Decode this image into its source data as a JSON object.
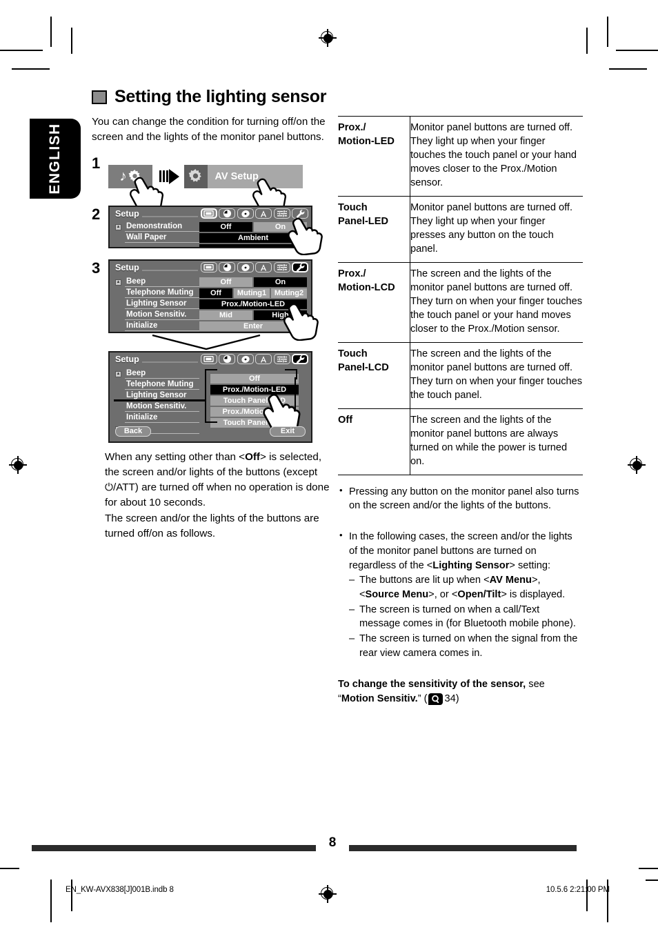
{
  "language_tab": "ENGLISH",
  "heading": "Setting the lighting sensor",
  "intro": "You can change the condition for turning off/on the screen and the lights of the monitor panel buttons.",
  "steps": {
    "one": {
      "number": "1",
      "source_icon": "music-note-gear-icon",
      "av_setup_label": "AV Setup",
      "av_setup_icon": "gear-icon",
      "arrow_icon": "right-arrow-icon"
    },
    "two": {
      "number": "2",
      "screen": {
        "title": "Setup",
        "tabs": [
          "monitor-icon",
          "clock-icon",
          "disc-icon",
          "text-a-icon",
          "equalizer-icon",
          "wrench-icon"
        ],
        "selected_tab_index": 0,
        "rows": [
          {
            "label": "Demonstration",
            "values": [
              {
                "text": "Off",
                "selected": true
              },
              {
                "text": "On",
                "selected": false
              }
            ]
          },
          {
            "label": "Wall Paper",
            "values": [
              {
                "text": "Ambient",
                "selected": true
              }
            ]
          }
        ]
      }
    },
    "three": {
      "number": "3",
      "screen_a": {
        "title": "Setup",
        "tabs": [
          "monitor-icon",
          "clock-icon",
          "disc-icon",
          "text-a-icon",
          "equalizer-icon",
          "wrench-icon"
        ],
        "selected_tab_index": 5,
        "rows": [
          {
            "label": "Beep",
            "values": [
              {
                "text": "Off",
                "selected": false
              },
              {
                "text": "On",
                "selected": true
              }
            ]
          },
          {
            "label": "Telephone Muting",
            "values": [
              {
                "text": "Off",
                "selected": true
              },
              {
                "text": "Muting1",
                "selected": false
              },
              {
                "text": "Muting2",
                "selected": false
              }
            ]
          },
          {
            "label": "Lighting Sensor",
            "values": [
              {
                "text": "Prox./Motion-LED",
                "selected": true
              }
            ]
          },
          {
            "label": "Motion Sensitiv.",
            "values": [
              {
                "text": "Mid",
                "selected": false
              },
              {
                "text": "High",
                "selected": true
              }
            ]
          },
          {
            "label": "Initialize",
            "values": [
              {
                "text": "Enter",
                "selected": false
              }
            ]
          }
        ]
      },
      "screen_b": {
        "title": "Setup",
        "tabs": [
          "monitor-icon",
          "clock-icon",
          "disc-icon",
          "text-a-icon",
          "equalizer-icon",
          "wrench-icon"
        ],
        "selected_tab_index": 5,
        "rows": [
          "Beep",
          "Telephone Muting",
          "Lighting Sensor",
          "Motion Sensitiv.",
          "Initialize"
        ],
        "dropdown": [
          {
            "text": "Off",
            "selected": false
          },
          {
            "text": "Prox./Motion-LED",
            "selected": true
          },
          {
            "text": "Touch Panel-LED",
            "selected": false
          },
          {
            "text": "Prox./Motion-LCD",
            "selected": false
          },
          {
            "text": "Touch Panel-LCD",
            "selected": false
          }
        ],
        "back_label": "Back",
        "exit_label": "Exit"
      }
    }
  },
  "left_note": {
    "line1_a": "When any setting other than <",
    "line1_b": "Off",
    "line1_c": "> is selected, the screen and/or lights of the buttons (except ⏻/ATT) are turned off when no operation is done for about 10 seconds.",
    "line2": "The screen and/or the lights of the buttons are turned off/on as follows."
  },
  "table": {
    "rows": [
      {
        "name": "Prox./\nMotion-LED",
        "desc": "Monitor panel buttons are turned off. They light up when your finger touches the touch panel or your hand moves closer to the Prox./Motion sensor."
      },
      {
        "name": "Touch\nPanel-LED",
        "desc": "Monitor panel buttons are turned off. They light up when your finger presses any button on the touch panel."
      },
      {
        "name": "Prox./\nMotion-LCD",
        "desc": "The screen and the lights of the monitor panel buttons are turned off. They turn on when your finger touches the touch panel or your hand moves closer to the Prox./Motion sensor."
      },
      {
        "name": "Touch\nPanel-LCD",
        "desc": "The screen and the lights of the monitor panel buttons are turned off. They turn on when your finger touches the touch panel."
      },
      {
        "name": "Off",
        "desc": "The screen and the lights of the monitor panel buttons are always turned on while the power is turned on."
      }
    ]
  },
  "notes": {
    "note1": "Pressing any button on the monitor panel also turns on the screen and/or the lights of the buttons.",
    "note2_intro_a": "In the following cases, the screen and/or the lights of the monitor panel buttons are turned on regardless of the <",
    "note2_intro_b": "Lighting Sensor",
    "note2_intro_c": "> setting:",
    "sub1_a": "The buttons are lit up when <",
    "sub1_b": "AV Menu",
    "sub1_c": ">, <",
    "sub1_d": "Source Menu",
    "sub1_e": ">, or <",
    "sub1_f": "Open/Tilt",
    "sub1_g": "> is displayed.",
    "sub2": "The screen is turned on when a call/Text message comes in (for Bluetooth mobile phone).",
    "sub3": "The screen is turned on when the signal from the rear view camera comes in."
  },
  "closing": {
    "bold": "To change the sensitivity of the sensor,",
    "normal": " see",
    "line2_open": "“",
    "line2_bold": "Motion Sensitiv.",
    "line2_close": "” (",
    "icon": "magnifier-icon",
    "page_ref": "34)"
  },
  "footer": {
    "page_number": "8",
    "file_name": "EN_KW-AVX838[J]001B.indb   8",
    "timestamp": "10.5.6   2:21:00 PM"
  },
  "colors": {
    "screen_bg": "#6e6e6e",
    "value_off": "#a3a3a3",
    "value_selected": "#000000",
    "tab_black": "#000000"
  }
}
